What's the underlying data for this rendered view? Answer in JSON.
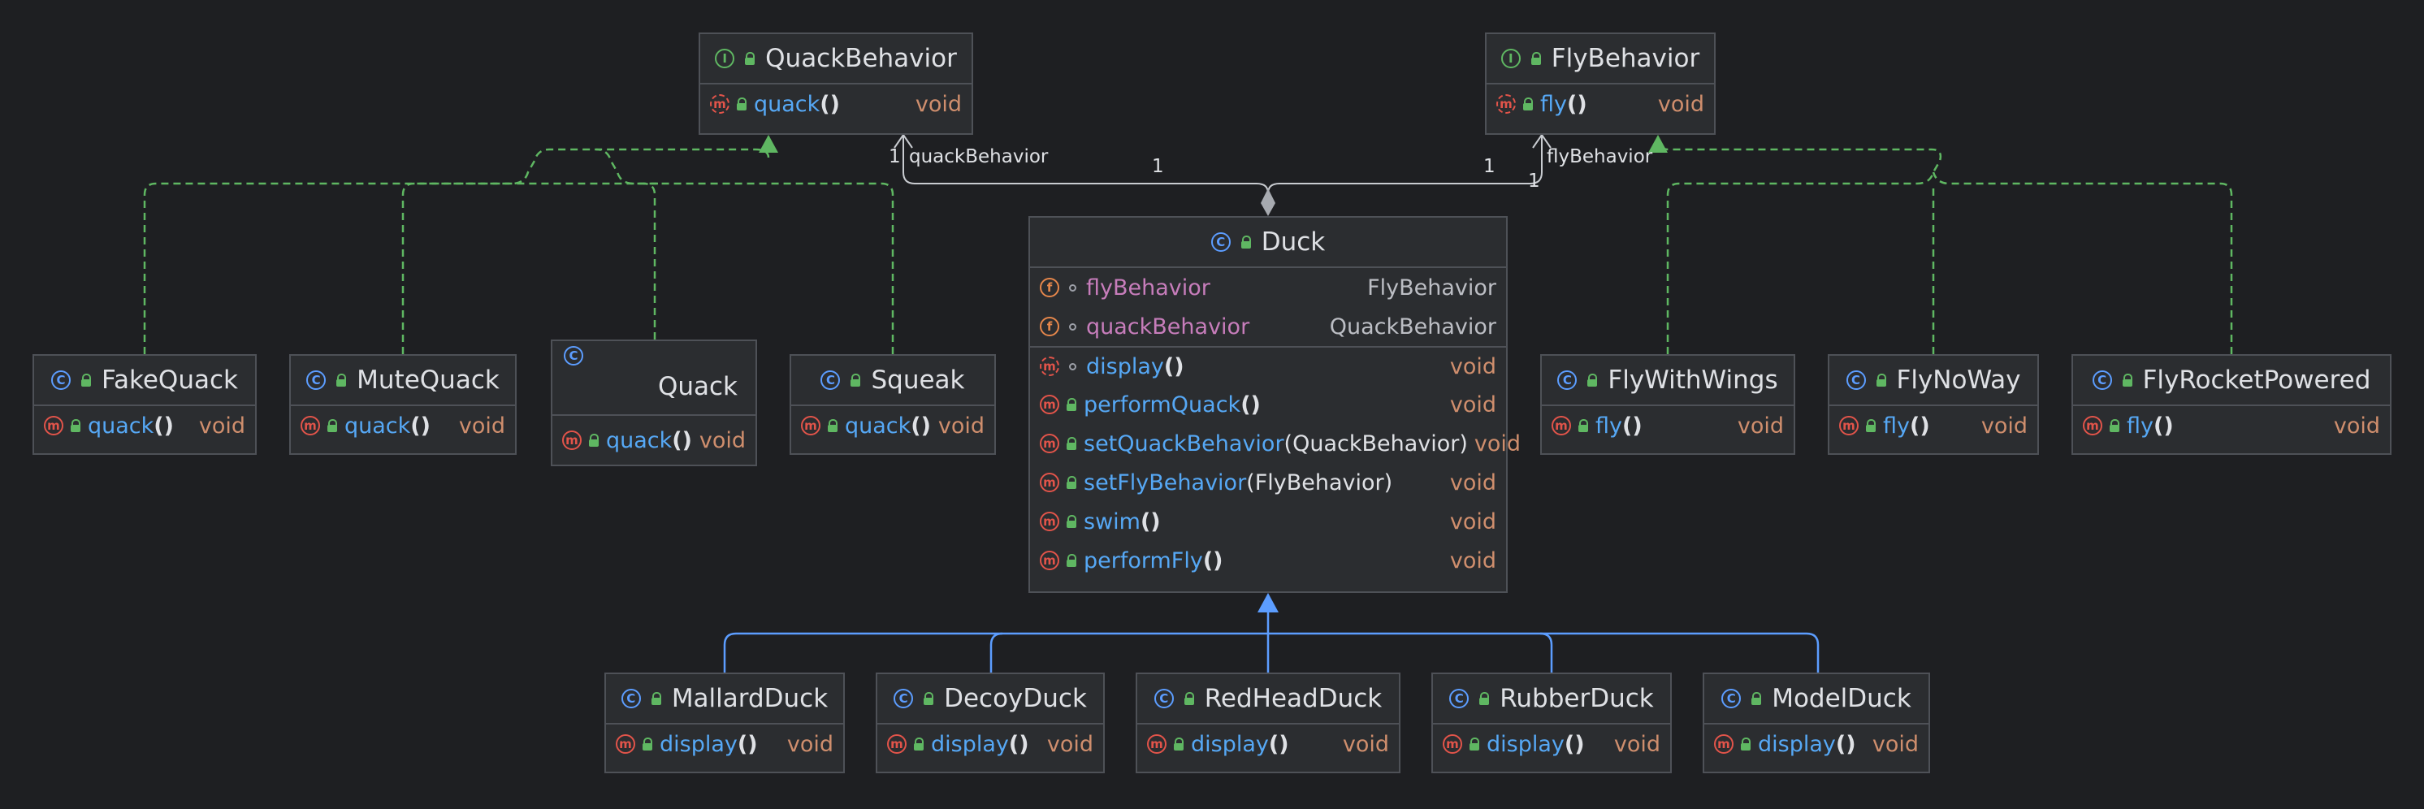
{
  "quack_behavior": {
    "name": "QuackBehavior",
    "kind_icon": "interface-icon",
    "method": {
      "name": "quack",
      "parens": "()",
      "return": "void"
    }
  },
  "fly_behavior": {
    "name": "FlyBehavior",
    "kind_icon": "interface-icon",
    "method": {
      "name": "fly",
      "parens": "()",
      "return": "void"
    }
  },
  "duck": {
    "name": "Duck",
    "kind_icon": "class-icon",
    "fields": [
      {
        "name": "flyBehavior",
        "type": "FlyBehavior"
      },
      {
        "name": "quackBehavior",
        "type": "QuackBehavior"
      }
    ],
    "methods": [
      {
        "name": "display",
        "parens": "()",
        "param": "",
        "return": "void"
      },
      {
        "name": "performQuack",
        "parens": "()",
        "param": "",
        "return": "void"
      },
      {
        "name": "setQuackBehavior",
        "parens": "",
        "param": "(QuackBehavior)",
        "return": "void"
      },
      {
        "name": "setFlyBehavior",
        "parens": "",
        "param": "(FlyBehavior)",
        "return": "void"
      },
      {
        "name": "swim",
        "parens": "()",
        "param": "",
        "return": "void"
      },
      {
        "name": "performFly",
        "parens": "()",
        "param": "",
        "return": "void"
      }
    ]
  },
  "quack_impls": [
    {
      "name": "FakeQuack",
      "method": "quack",
      "parens": "()",
      "return": "void"
    },
    {
      "name": "MuteQuack",
      "method": "quack",
      "parens": "()",
      "return": "void"
    },
    {
      "name": "Quack",
      "method": "quack",
      "parens": "()",
      "return": "void"
    },
    {
      "name": "Squeak",
      "method": "quack",
      "parens": "()",
      "return": "void"
    }
  ],
  "fly_impls": [
    {
      "name": "FlyWithWings",
      "method": "fly",
      "parens": "()",
      "return": "void"
    },
    {
      "name": "FlyNoWay",
      "method": "fly",
      "parens": "()",
      "return": "void"
    },
    {
      "name": "FlyRocketPowered",
      "method": "fly",
      "parens": "()",
      "return": "void"
    }
  ],
  "duck_subclasses": [
    {
      "name": "MallardDuck",
      "method": "display",
      "parens": "()",
      "return": "void"
    },
    {
      "name": "DecoyDuck",
      "method": "display",
      "parens": "()",
      "return": "void"
    },
    {
      "name": "RedHeadDuck",
      "method": "display",
      "parens": "()",
      "return": "void"
    },
    {
      "name": "RubberDuck",
      "method": "display",
      "parens": "()",
      "return": "void"
    },
    {
      "name": "ModelDuck",
      "method": "display",
      "parens": "()",
      "return": "void"
    }
  ],
  "associations": {
    "quack": {
      "role": "quackBehavior",
      "mult_target": "1",
      "mult_source": "1"
    },
    "fly": {
      "role": "flyBehavior",
      "mult_target": "1",
      "mult_source": "1"
    }
  },
  "icons": {
    "class": "C",
    "interface": "I",
    "method": "m",
    "field": "f"
  },
  "colors": {
    "background": "#1e1f22",
    "box": "#2b2d30",
    "border": "#4e5157",
    "method_name": "#56a8f5",
    "field_name": "#c77dbb",
    "return_type": "#cf8e6d",
    "realization_edge": "#5fb762",
    "generalization_edge": "#5c9dff",
    "association_edge": "#c9ccd1"
  }
}
